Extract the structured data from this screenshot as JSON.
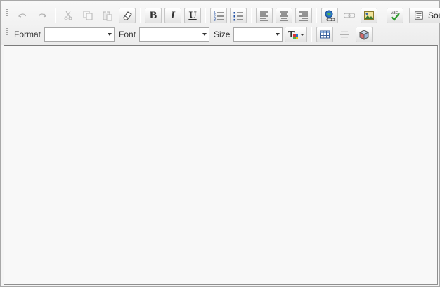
{
  "editor": {
    "toolbar": {
      "undo_label": "Undo",
      "redo_label": "Redo",
      "cut_label": "Cut",
      "copy_label": "Copy",
      "paste_label": "Paste",
      "remove_format_label": "Remove Format",
      "bold_glyph": "B",
      "italic_glyph": "I",
      "underline_glyph": "U",
      "source_label": "Source",
      "format_label": "Format",
      "font_label": "Font",
      "size_label": "Size",
      "format_value": "",
      "font_value": "",
      "size_value": ""
    },
    "content_text": ""
  },
  "colors": {
    "toolbar_bg": "#ececec",
    "content_bg": "#f8f8f8",
    "border": "#a8a8a8"
  }
}
